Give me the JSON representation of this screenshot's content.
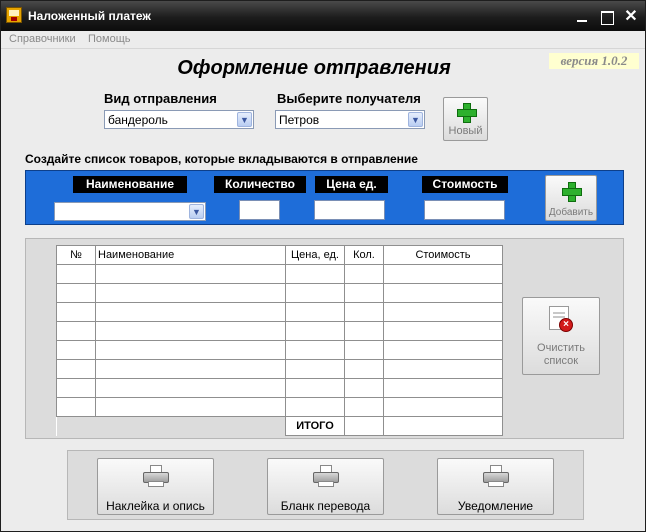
{
  "window": {
    "title": "Наложенный платеж"
  },
  "menu": {
    "items": [
      "Справочники",
      "Помощь"
    ]
  },
  "version": "версия 1.0.2",
  "page_title": "Оформление отправления",
  "shipment_type": {
    "label": "Вид отправления",
    "value": "бандероль"
  },
  "recipient": {
    "label": "Выберите получателя",
    "value": "Петров"
  },
  "new_button": {
    "label": "Новый",
    "icon": "add-plus-icon"
  },
  "list_caption": "Создайте список товаров, которые вкладываются в отправление",
  "item_form": {
    "name_header": "Наименование",
    "quantity_header": "Количество",
    "unit_price_header": "Цена ед.",
    "cost_header": "Стоимость",
    "name_value": "",
    "quantity_value": "",
    "unit_price_value": "",
    "cost_value": "",
    "add_button": "Добавить"
  },
  "table": {
    "columns": [
      "№",
      "Наименование",
      "Цена, ед.",
      "Кол.",
      "Стоимость"
    ],
    "empty_rows": 8,
    "total_label": "ИТОГО"
  },
  "clear_button": {
    "line1": "Очистить",
    "line2": "список"
  },
  "print_buttons": {
    "sticker": "Наклейка и опись",
    "transfer_form": "Бланк перевода",
    "notification": "Уведомление"
  },
  "colors": {
    "panel_blue": "#1e6dd9",
    "version_bg": "#ffffd0",
    "plus_green": "#2db02d"
  }
}
